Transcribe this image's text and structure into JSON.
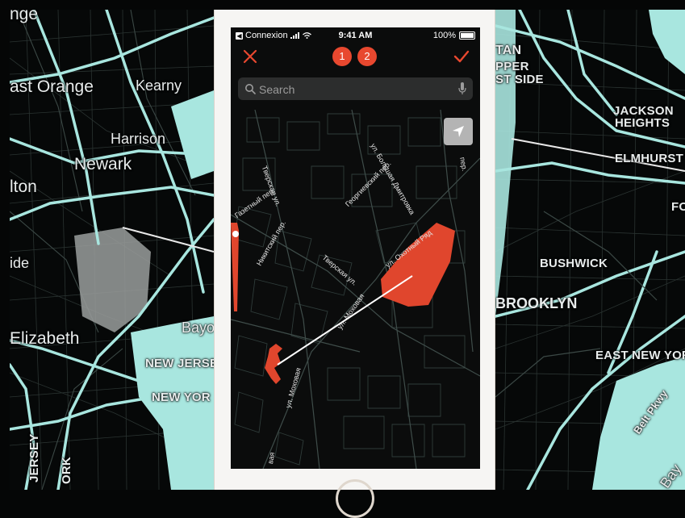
{
  "left_map": {
    "labels": [
      "nge",
      "ast Orange",
      "Kearny",
      "Harrison",
      "Newark",
      "lton",
      "ide",
      "Elizabeth",
      "Bayo",
      "NEW JERSE",
      "NEW YOR",
      "JERSEY",
      "ORK"
    ]
  },
  "right_map": {
    "labels": [
      "TAN",
      "PPER",
      "ST SIDE",
      "JACKSON",
      "HEIGHTS",
      "ELMHURST",
      "FO",
      "BUSHWICK",
      "BROOKLYN",
      "EAST NEW YORK",
      "Belt Pkwy",
      "Bay"
    ]
  },
  "status_bar": {
    "back_label": "Connexion",
    "time": "9:41 AM",
    "battery": "100%"
  },
  "toolbar": {
    "step_1": "1",
    "step_2": "2"
  },
  "search": {
    "placeholder": "Search"
  },
  "streets": [
    "Тверская ул.",
    "Газетный пер.",
    "Никитский пер.",
    "Георгиевский пер.",
    "ул. Большая Дмитровка",
    "ул. Охотный Ряд",
    "Тверская ул.",
    "ул. Моховая",
    "ул. Моховая",
    "вая",
    "пер."
  ],
  "colors": {
    "accent": "#e8482f",
    "roads_major": "#a8e6df",
    "map_bg": "#060808",
    "route_line": "#ffffff"
  }
}
